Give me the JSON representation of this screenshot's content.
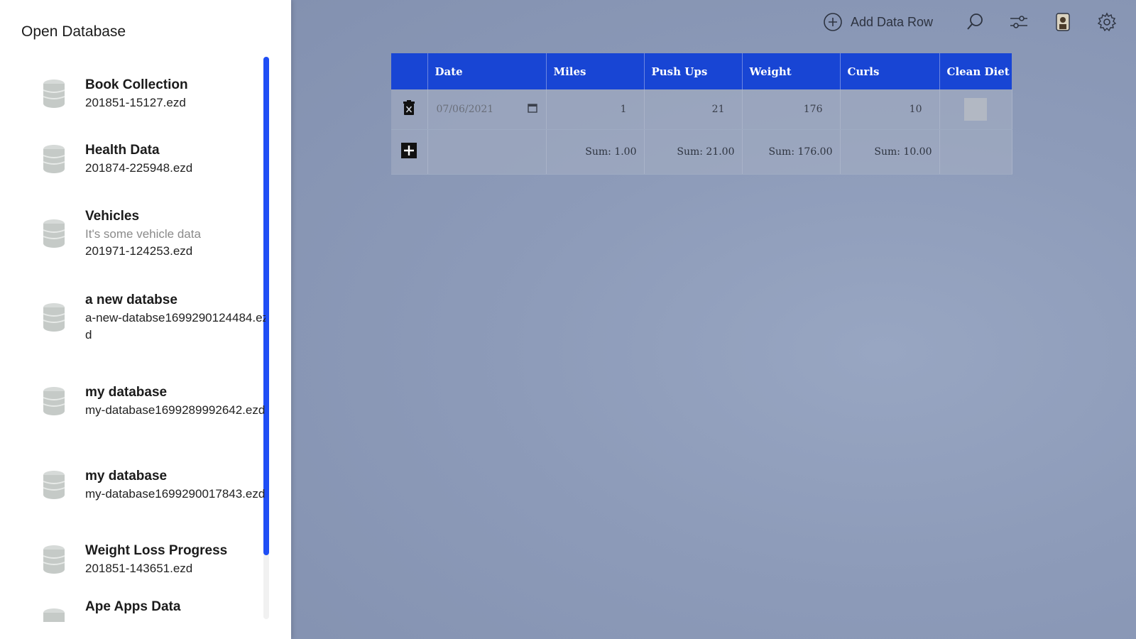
{
  "sidebar": {
    "title": "Open Database",
    "items": [
      {
        "name": "Book Collection",
        "description": "",
        "file": "201851-15127.ezd"
      },
      {
        "name": "Health Data",
        "description": "",
        "file": "201874-225948.ezd"
      },
      {
        "name": "Vehicles",
        "description": "It's some vehicle data",
        "file": "201971-124253.ezd"
      },
      {
        "name": "a new databse",
        "description": "",
        "file": "a-new-databse1699290124484.ezd"
      },
      {
        "name": "my database",
        "description": "",
        "file": "my-database1699289992642.ezd"
      },
      {
        "name": "my database",
        "description": "",
        "file": "my-database1699290017843.ezd"
      },
      {
        "name": "Weight Loss Progress",
        "description": "",
        "file": "201851-143651.ezd"
      },
      {
        "name": "Ape Apps Data",
        "description": "",
        "file": ""
      }
    ]
  },
  "toolbar": {
    "add_label": "Add Data Row",
    "icons": [
      "add-circle-icon",
      "search-icon",
      "filter-sliders-icon",
      "profile-icon",
      "gear-icon"
    ]
  },
  "table": {
    "columns": [
      "Date",
      "Miles",
      "Push Ups",
      "Weight",
      "Curls",
      "Clean Diet"
    ],
    "row": {
      "date": "07/06/2021",
      "miles": "1",
      "push_ups": "21",
      "weight": "176",
      "curls": "10",
      "clean_diet": false
    },
    "sums": {
      "miles": "Sum: 1.00",
      "push_ups": "Sum: 21.00",
      "weight": "Sum: 176.00",
      "curls": "Sum: 10.00"
    }
  },
  "colors": {
    "header_blue": "#1845d4",
    "scroll_thumb": "#1f4ef5",
    "background": "#8796b4"
  }
}
